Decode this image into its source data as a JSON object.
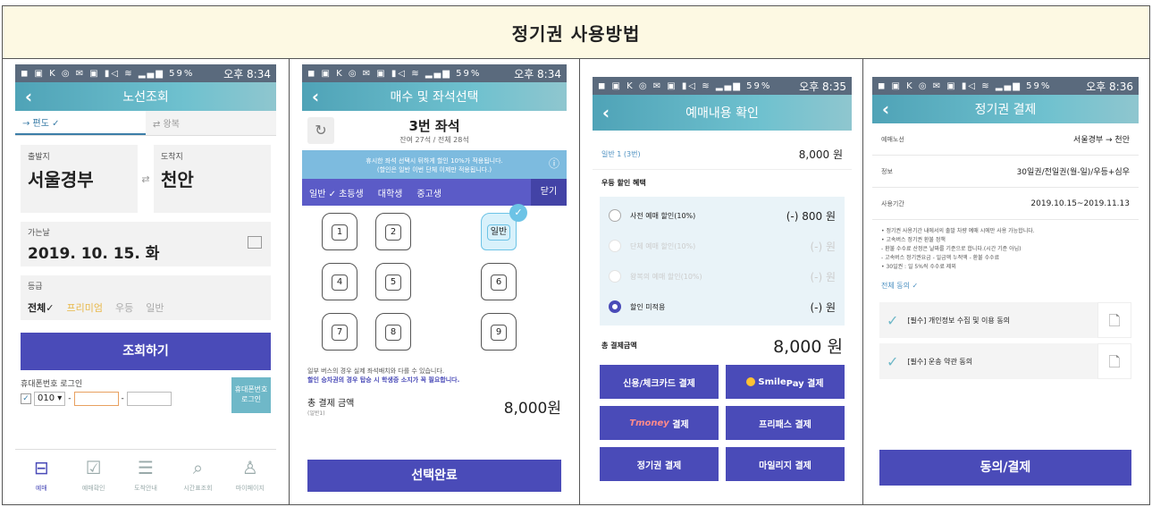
{
  "header": {
    "title": "정기권 사용방법"
  },
  "status": {
    "icons": "◼ ▣ K ◎ ✉ ▣  ▮◁ ≋ ▂▄▆ 59%",
    "time1": "오후 8:34",
    "time3": "오후 8:35",
    "time4": "오후 8:36"
  },
  "screen1": {
    "title": "노선조회",
    "tab_oneway": "→ 편도 ✓",
    "tab_round": "⇄ 왕복",
    "depart_label": "출발지",
    "depart_value": "서울경부",
    "arrive_label": "도착지",
    "arrive_value": "천안",
    "date_label": "가는날",
    "date_value": "2019. 10. 15. 화",
    "grade_label": "등급",
    "grade_all": "전체✓",
    "grade_premium": "프리미엄",
    "grade_excellent": "우등",
    "grade_general": "일반",
    "search_button": "조회하기",
    "login_label": "휴대폰번호 로그인",
    "phone_prefix": "010 ▾",
    "login_button": "휴대폰번호 로그인",
    "tabs": [
      "예매",
      "예매확인",
      "도착안내",
      "시간표조회",
      "마이페이지"
    ]
  },
  "screen2": {
    "title": "매수 및 좌석선택",
    "seat_title": "3번 좌석",
    "seat_sub": "잔여 27석 / 전체 28석",
    "banner_line1": "휴시한 좌석 선택시 뒤하게 할인 10%가 적용됩니다.",
    "banner_line2": "(할인은 일반 이번 단체 이제만 적용됩니다.)",
    "types": [
      "일반 ✓ 초등생",
      "대학생",
      "중고생"
    ],
    "close": "닫기",
    "seats": [
      "1",
      "2",
      "일반",
      "4",
      "5",
      "6",
      "7",
      "8",
      "9"
    ],
    "notice1": "일부 버스의 경우 실제 좌석배치와 다를 수 있습니다.",
    "notice2": "할인 승차권의 경우 탑승 시 학생증 소지가 꼭 필요합니다.",
    "total_label": "총 결제 금액",
    "total_sub": "(일반1)",
    "total_amount": "8,000원",
    "confirm_button": "선택완료"
  },
  "screen3": {
    "title": "예매내용 확인",
    "general_label": "일반 1 (3번)",
    "general_amount": "8,000 원",
    "discount_title": "우등 할인 혜택",
    "options": [
      {
        "label": "사전 예매 할인(10%)",
        "amount": "(-) 800 원"
      },
      {
        "label": "단체 예매 할인(10%)",
        "amount": "(-) 원"
      },
      {
        "label": "왕복의 예매 할인(10%)",
        "amount": "(-) 원"
      },
      {
        "label": "할인 미적용",
        "amount": "(-) 원"
      }
    ],
    "total_label": "총 결제금액",
    "total_amount": "8,000 원",
    "pay_card": "신용/체크카드 결제",
    "pay_smile_brand": "Smile",
    "pay_smile_pay": "Pay 결제",
    "pay_tmoney_brand": "Tmoney",
    "pay_tmoney_suffix": "결제",
    "pay_freepass": "프리패스 결제",
    "pay_season": "정기권 결제",
    "pay_mileage": "마일리지 결제"
  },
  "screen4": {
    "title": "정기권 결제",
    "route_label": "예매노선",
    "route_value": "서울경부 → 천안",
    "info_label": "정보",
    "info_value": "30일권/전일권(월-일)/우등+심우",
    "period_label": "사용기간",
    "period_value": "2019.10.15~2019.11.13",
    "notes": [
      "• 정기권 사용기간 내에서의 출발 차량 예매 시에만 사용 가능합니다.",
      "• 고속버스 정기권 환불 정책",
      "- 환불 수수료 산정은 날짜를 기준으로 합니다.(시간 기준 아님)",
      "- 고속버스 정기권요금 - 일금액 누적액 - 환불 수수료",
      "  • 30일권 : 일 5%씩 수수료 제외"
    ],
    "agree_all": "전체 동의 ✓",
    "agree1": "[필수] 개인정보 수집 및 이용 동의",
    "agree2": "[필수] 운송 약관 동의",
    "pay_button": "동의/결제"
  }
}
